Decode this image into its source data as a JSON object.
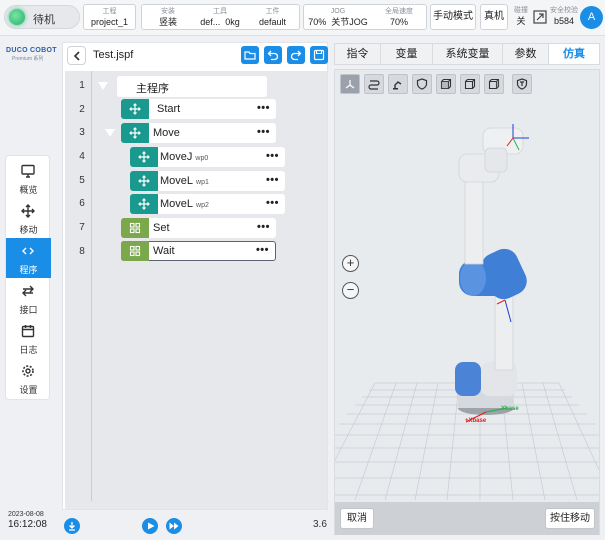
{
  "topbar": {
    "status": "待机",
    "project": {
      "label": "工程",
      "value": "project_1"
    },
    "install": {
      "label": "安装",
      "value": "竖装"
    },
    "tool": {
      "label": "工具",
      "name": "def...",
      "weight": "0kg"
    },
    "workpiece": {
      "label": "工件",
      "value": "default"
    },
    "jog": {
      "label": "JOG",
      "speed": "70%",
      "mode": "关节JOG"
    },
    "global_speed": {
      "label": "全局速度",
      "value": "70%"
    },
    "manual_mode": "手动模式",
    "real_machine": "真机",
    "collision": {
      "label": "碰撞",
      "value": "关"
    },
    "safety_check": {
      "label": "安全校验",
      "value": "b584"
    },
    "avatar": "A"
  },
  "brand": {
    "name": "DUCO COBOT",
    "sub": "Premium 系列"
  },
  "sidebar": {
    "items": [
      {
        "label": "概览",
        "icon": "monitor-icon"
      },
      {
        "label": "移动",
        "icon": "move-icon"
      },
      {
        "label": "程序",
        "icon": "code-icon"
      },
      {
        "label": "接口",
        "icon": "swap-icon"
      },
      {
        "label": "日志",
        "icon": "calendar-icon"
      },
      {
        "label": "设置",
        "icon": "gear-icon"
      }
    ]
  },
  "datetime": {
    "date": "2023-08-08",
    "time": "16:12:08"
  },
  "program": {
    "file_name": "Test.jspf",
    "root_label": "主程序",
    "line_numbers": [
      "1",
      "2",
      "3",
      "4",
      "5",
      "6",
      "7",
      "8"
    ],
    "nodes": [
      {
        "label": "Start",
        "sub": ""
      },
      {
        "label": "Move",
        "sub": ""
      },
      {
        "label": "MoveJ",
        "sub": "wp0"
      },
      {
        "label": "MoveL",
        "sub": "wp1"
      },
      {
        "label": "MoveL",
        "sub": "wp2"
      },
      {
        "label": "Set",
        "sub": ""
      },
      {
        "label": "Wait",
        "sub": ""
      }
    ],
    "menu_glyph": "•••",
    "speed": "3.6"
  },
  "right": {
    "tabs": [
      "指令",
      "变量",
      "系统变量",
      "参数",
      "仿真"
    ],
    "active_tab": "仿真",
    "zoom_in": "+",
    "zoom_out": "−",
    "axis_labels": {
      "x": "+Xbase",
      "y": "Ybase"
    },
    "cancel": "取消",
    "hold_to_move": "按住移动"
  },
  "colors": {
    "accent": "#1a8ee6",
    "teal": "#1a9a8e",
    "green": "#7aa84a",
    "robot_blue": "#3f7fd6"
  }
}
